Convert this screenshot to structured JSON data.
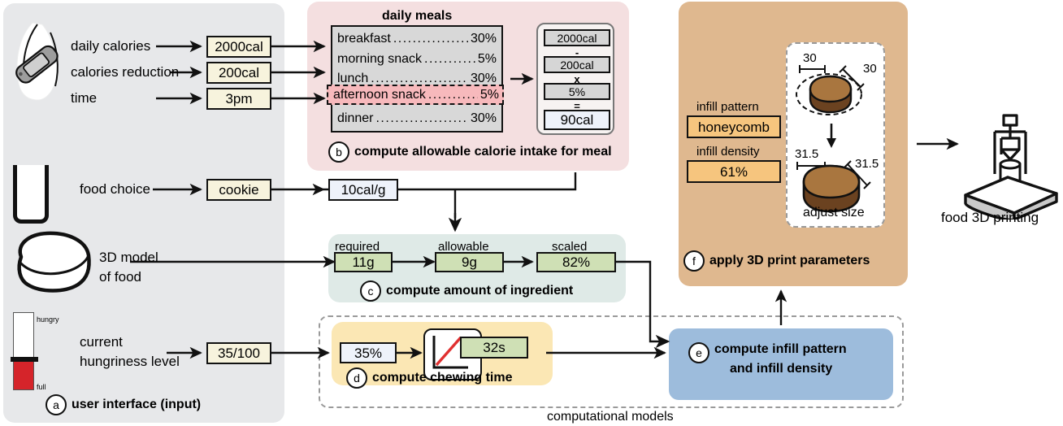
{
  "title": "food 3D printing personalization pipeline",
  "panels": {
    "a": {
      "letter": "a",
      "caption": "user interface (input)"
    },
    "b": {
      "letter": "b",
      "caption": "compute allowable calorie intake for meal",
      "heading": "daily meals"
    },
    "c": {
      "letter": "c",
      "caption": "compute amount of ingredient"
    },
    "d": {
      "letter": "d",
      "caption": "compute chewing time"
    },
    "e": {
      "letter": "e",
      "caption_line1": "compute infill pattern",
      "caption_line2": "and infill density"
    },
    "f": {
      "letter": "f",
      "caption": "apply 3D print parameters"
    }
  },
  "computational_models_label": "computational models",
  "user_interface": {
    "inputs": [
      {
        "label": "daily calories",
        "value": "2000cal"
      },
      {
        "label": "calories reduction",
        "value": "200cal"
      },
      {
        "label": "time",
        "value": "3pm"
      }
    ],
    "food_choice": {
      "label": "food choice",
      "value": "cookie"
    },
    "model": {
      "label_line1": "3D model",
      "label_line2": "of food"
    },
    "hungriness": {
      "label_line1": "current",
      "label_line2": "hungriness level",
      "value": "35/100",
      "top_tick": "hungry",
      "bottom_tick": "full"
    }
  },
  "daily_meals": [
    {
      "name": "breakfast",
      "pct": "30%",
      "highlighted": false
    },
    {
      "name": "morning snack",
      "pct": "5%",
      "highlighted": false
    },
    {
      "name": "lunch",
      "pct": "30%",
      "highlighted": false
    },
    {
      "name": "afternoon snack",
      "pct": "5%",
      "highlighted": true
    },
    {
      "name": "dinner",
      "pct": "30%",
      "highlighted": false
    }
  ],
  "calculator": {
    "operand1": "2000cal",
    "op1": "-",
    "operand2": "200cal",
    "op2": "x",
    "operand3": "5%",
    "op3": "=",
    "result": "90cal"
  },
  "energy_density": "10cal/g",
  "ingredient": {
    "required": {
      "label": "required",
      "value": "11g"
    },
    "allowable": {
      "label": "allowable",
      "value": "9g"
    },
    "scaled": {
      "label": "scaled",
      "value": "82%"
    }
  },
  "chewing": {
    "hunger_pct": "35%",
    "time": "32s"
  },
  "print_params": {
    "infill_pattern_label": "infill pattern",
    "infill_pattern_value": "honeycomb",
    "infill_density_label": "infill density",
    "infill_density_value": "61%",
    "dims_before": {
      "w": "30",
      "d": "30"
    },
    "dims_after": {
      "w": "31.5",
      "d": "31.5"
    },
    "adjust_caption": "adjust size"
  },
  "printer": {
    "caption": "food 3D printing"
  },
  "colors": {
    "panel_a": "#e7e8ea",
    "panel_b": "#f4dfe0",
    "panel_c": "#dfeae7",
    "panel_d": "#fbe7b4",
    "panel_e": "#9dbcdc",
    "panel_f": "#dfb88f",
    "value_box": "#f7f3dd",
    "green_box": "#cfe0b5",
    "orange_box": "#f6c57e",
    "highlight_pink": "#f7b9bc",
    "cookie_top": "#a9763f",
    "cookie_side": "#6b4220",
    "slider_full": "#d5242a",
    "cup_fill": "#fbb117"
  }
}
